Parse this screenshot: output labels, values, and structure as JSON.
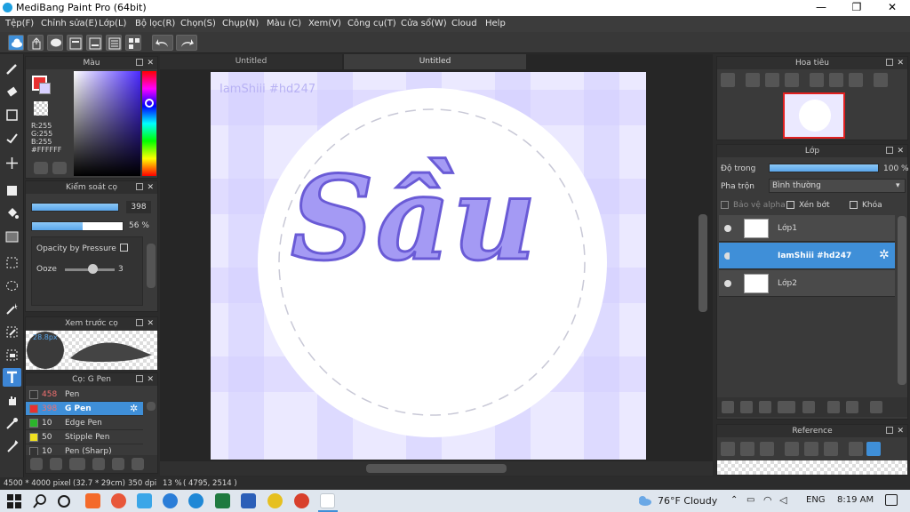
{
  "window": {
    "title": "MediBang Paint Pro (64bit)"
  },
  "menu": [
    "Tệp(F)",
    "Chỉnh sửa(E)",
    "Lớp(L)",
    "Bộ lọc(R)",
    "Chọn(S)",
    "Chụp(N)",
    "Màu (C)",
    "Xem(V)",
    "Công cụ(T)",
    "Cửa sổ(W)",
    "Cloud",
    "Help"
  ],
  "color_panel": {
    "title": "Màu",
    "r": "R:255",
    "g": "G:255",
    "b": "B:255",
    "hex": "#FFFFFF"
  },
  "brush_control": {
    "title": "Kiểm soát cọ",
    "size": "398",
    "opacity": "56 %",
    "opacity_by_pressure": "Opacity by Pressure",
    "ooze_label": "Ooze",
    "ooze_value": "3",
    "size_fill": 0.95,
    "opacity_fill": 0.56
  },
  "brush_preview": {
    "title": "Xem trước cọ",
    "size_label": "28.8px"
  },
  "brush_list": {
    "title": "Cọ: G Pen",
    "items": [
      {
        "size": "458",
        "name": "Pen",
        "color": "#333333"
      },
      {
        "size": "398",
        "name": "G Pen",
        "color": "#e83030"
      },
      {
        "size": "10",
        "name": "Edge Pen",
        "color": "#2bb52b"
      },
      {
        "size": "50",
        "name": "Stipple Pen",
        "color": "#f0e020"
      },
      {
        "size": "10",
        "name": "Pen (Sharp)",
        "color": "#333333"
      }
    ]
  },
  "tabs": [
    "Untitled",
    "Untitled"
  ],
  "canvas": {
    "watermark": "IamShiii #hd247",
    "lettering": "Sầu"
  },
  "navigator": {
    "title": "Hoa tiêu"
  },
  "layer_panel": {
    "title": "Lớp",
    "opacity_label": "Độ trong",
    "opacity_value": "100 %",
    "blend_label": "Pha trộn",
    "blend_value": "Bình thường",
    "protect_alpha": "Bảo vệ alpha",
    "clipping": "Xén bớt",
    "lock": "Khóa",
    "layers": [
      {
        "name": "Lớp1",
        "selected": false
      },
      {
        "name": "IamShiii #hd247",
        "selected": true
      },
      {
        "name": "Lớp2",
        "selected": false
      }
    ]
  },
  "reference": {
    "title": "Reference"
  },
  "status": {
    "size": "4500 * 4000 pixel",
    "cm": "(32.7 * 29cm)",
    "dpi": "350 dpi",
    "zoom": "13 %",
    "coords": "( 4795, 2514 )"
  },
  "taskbar": {
    "weather": "76°F  Cloudy",
    "lang": "ENG",
    "time": "8:19 AM"
  },
  "colors": {
    "accent": "#3f8fd8",
    "lettering_fill": "#a49af4",
    "lettering_stroke": "#6a5bd6",
    "primary_color": "#e83030"
  }
}
